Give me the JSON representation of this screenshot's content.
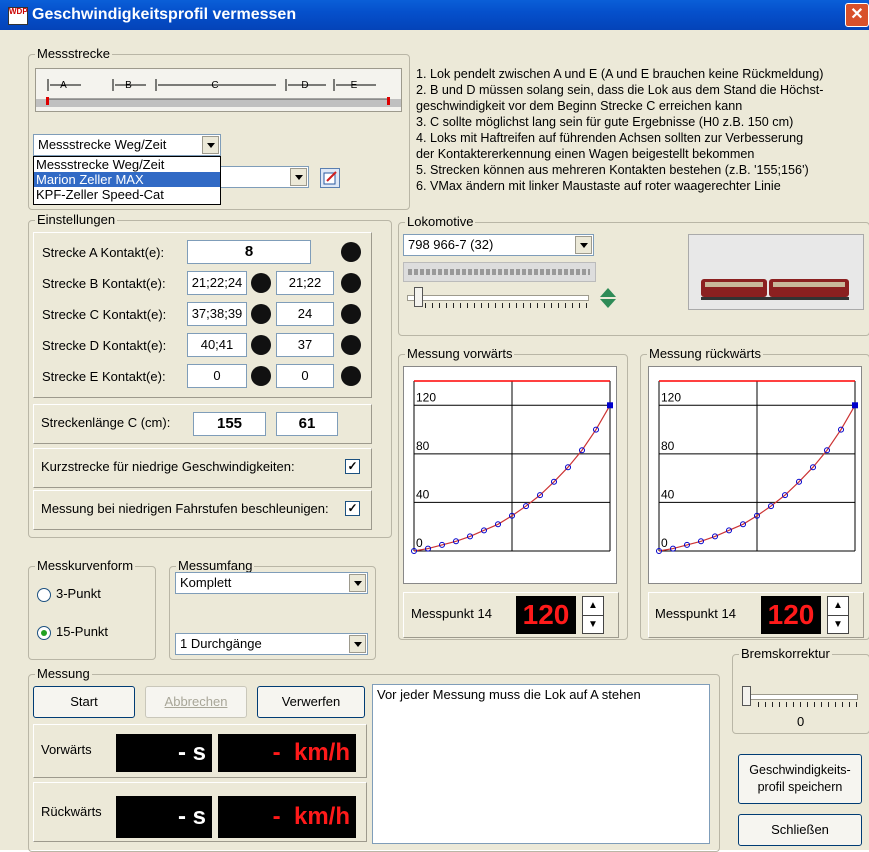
{
  "window": {
    "title": "Geschwindigkeitsprofil vermessen",
    "icon_text": "WDP",
    "close_label": "✕"
  },
  "messstrecke": {
    "group_label": "Messstrecke",
    "segments": [
      "A",
      "B",
      "C",
      "D",
      "E"
    ],
    "type_combo_value": "Messstrecke Weg/Zeit",
    "type_options": [
      "Messstrecke Weg/Zeit",
      "Marion Zeller MAX",
      "KPF-Zeller Speed-Cat"
    ],
    "type_selected_index": 1,
    "second_combo_value": ""
  },
  "instructions": [
    "1. Lok pendelt zwischen A und E (A und E brauchen keine Rückmeldung)",
    "2. B und D müssen solang sein, dass die Lok aus dem Stand die Höchst-",
    "    geschwindigkeit vor dem Beginn Strecke C erreichen kann",
    "3. C sollte möglichst lang sein für gute Ergebnisse (H0 z.B. 150 cm)",
    "4. Loks mit Haftreifen auf führenden Achsen sollten zur Verbesserung",
    "    der Kontaktererkennung einen Wagen beigestellt bekommen",
    "5. Strecken können aus mehreren Kontakten bestehen (z.B. '155;156')",
    "6. VMax ändern mit linker Maustaste auf roter waagerechter Linie"
  ],
  "einstellungen": {
    "group_label": "Einstellungen",
    "rows": [
      {
        "label": "Strecke A Kontakt(e):",
        "v1": "8",
        "v2": null
      },
      {
        "label": "Strecke B Kontakt(e):",
        "v1": "21;22;24",
        "v2": "21;22"
      },
      {
        "label": "Strecke C Kontakt(e):",
        "v1": "37;38;39",
        "v2": "24"
      },
      {
        "label": "Strecke D Kontakt(e):",
        "v1": "40;41",
        "v2": "37"
      },
      {
        "label": "Strecke E Kontakt(e):",
        "v1": "0",
        "v2": "0"
      }
    ],
    "length_label": "Streckenlänge C (cm):",
    "length_v1": "155",
    "length_v2": "61",
    "short_label": "Kurzstrecke für niedrige Geschwindigkeiten:",
    "short_checked": true,
    "accel_label": "Messung bei niedrigen Fahrstufen beschleunigen:",
    "accel_checked": true
  },
  "messkurvenform": {
    "group_label": "Messkurvenform",
    "options": [
      "3-Punkt",
      "15-Punkt"
    ],
    "selected": "15-Punkt"
  },
  "messumfang": {
    "group_label": "Messumfang",
    "scope_value": "Komplett",
    "passes_value": "1 Durchgänge"
  },
  "lokomotive": {
    "group_label": "Lokomotive",
    "selected": "798 966-7 (32)",
    "slider_level": 0.05
  },
  "forward": {
    "group_label": "Messung vorwärts",
    "point_label": "Messpunkt 14",
    "value": "120"
  },
  "backward": {
    "group_label": "Messung rückwärts",
    "point_label": "Messpunkt 14",
    "value": "120"
  },
  "chart_data": [
    {
      "type": "line",
      "title": "Messung vorwärts",
      "xlim": [
        0,
        14
      ],
      "ylim": [
        0,
        140
      ],
      "y_ticks": [
        0,
        40,
        80,
        120
      ],
      "vmax_line": 140,
      "x": [
        0,
        1,
        2,
        3,
        4,
        5,
        6,
        7,
        8,
        9,
        10,
        11,
        12,
        13,
        14
      ],
      "values": [
        0,
        2,
        5,
        8,
        12,
        17,
        22,
        29,
        37,
        46,
        57,
        69,
        83,
        100,
        120
      ],
      "grid": true
    },
    {
      "type": "line",
      "title": "Messung rückwärts",
      "xlim": [
        0,
        14
      ],
      "ylim": [
        0,
        140
      ],
      "y_ticks": [
        0,
        40,
        80,
        120
      ],
      "vmax_line": 140,
      "x": [
        0,
        1,
        2,
        3,
        4,
        5,
        6,
        7,
        8,
        9,
        10,
        11,
        12,
        13,
        14
      ],
      "values": [
        0,
        2,
        5,
        8,
        12,
        17,
        22,
        29,
        37,
        46,
        57,
        69,
        83,
        100,
        120
      ],
      "grid": true
    }
  ],
  "messung": {
    "group_label": "Messung",
    "start_label": "Start",
    "abort_label": "Abbrechen",
    "discard_label": "Verwerfen",
    "forward_label": "Vorwärts",
    "backward_label": "Rückwärts",
    "sec_value": "-",
    "sec_unit": "s",
    "kmh_value": "-",
    "kmh_unit": "km/h",
    "log_text": "Vor jeder Messung muss die Lok auf A stehen"
  },
  "bremskorrektur": {
    "group_label": "Bremskorrektur",
    "value": "0",
    "slider_level": 0.0
  },
  "footer": {
    "save_label": "Geschwindigkeits-\nprofil speichern",
    "close_label": "Schließen"
  },
  "colors": {
    "titlebar": "#0550cc",
    "vmax_line": "#ff0000",
    "curve": "#cc3333",
    "points": "#0000cc",
    "led_text": "#ff1a1a"
  }
}
